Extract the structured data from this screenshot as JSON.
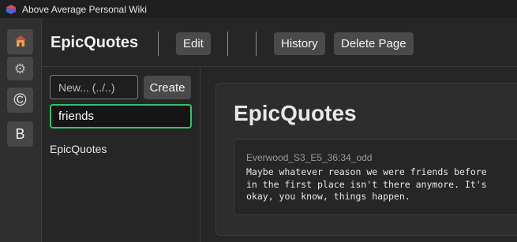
{
  "window": {
    "title": "Above Average Personal Wiki",
    "app_icon": "cube-icon"
  },
  "rail": {
    "items": [
      {
        "name": "home",
        "icon": "house-icon",
        "glyph": "🏠"
      },
      {
        "name": "settings",
        "icon": "gear-icon",
        "glyph": "⚙"
      },
      {
        "name": "copyright",
        "icon": "copyright-icon",
        "glyph": "©"
      },
      {
        "name": "bold",
        "icon": "bold-icon",
        "glyph": "B"
      }
    ]
  },
  "header": {
    "title": "EpicQuotes",
    "edit_label": "Edit",
    "history_label": "History",
    "delete_label": "Delete Page"
  },
  "sidebar": {
    "new_placeholder": "New... (../..)",
    "create_label": "Create",
    "search_value": "friends",
    "results": [
      "EpicQuotes"
    ]
  },
  "main": {
    "title": "EpicQuotes",
    "quote": {
      "label": "Everwood_S3_E5_36:34_odd",
      "text": "Maybe whatever reason we were friends before\nin the first place isn't there anymore. It's\nokay, you know, things happen."
    }
  },
  "colors": {
    "accent_focus": "#2ec46a",
    "background": "#262626",
    "button": "#4a4a4a"
  }
}
